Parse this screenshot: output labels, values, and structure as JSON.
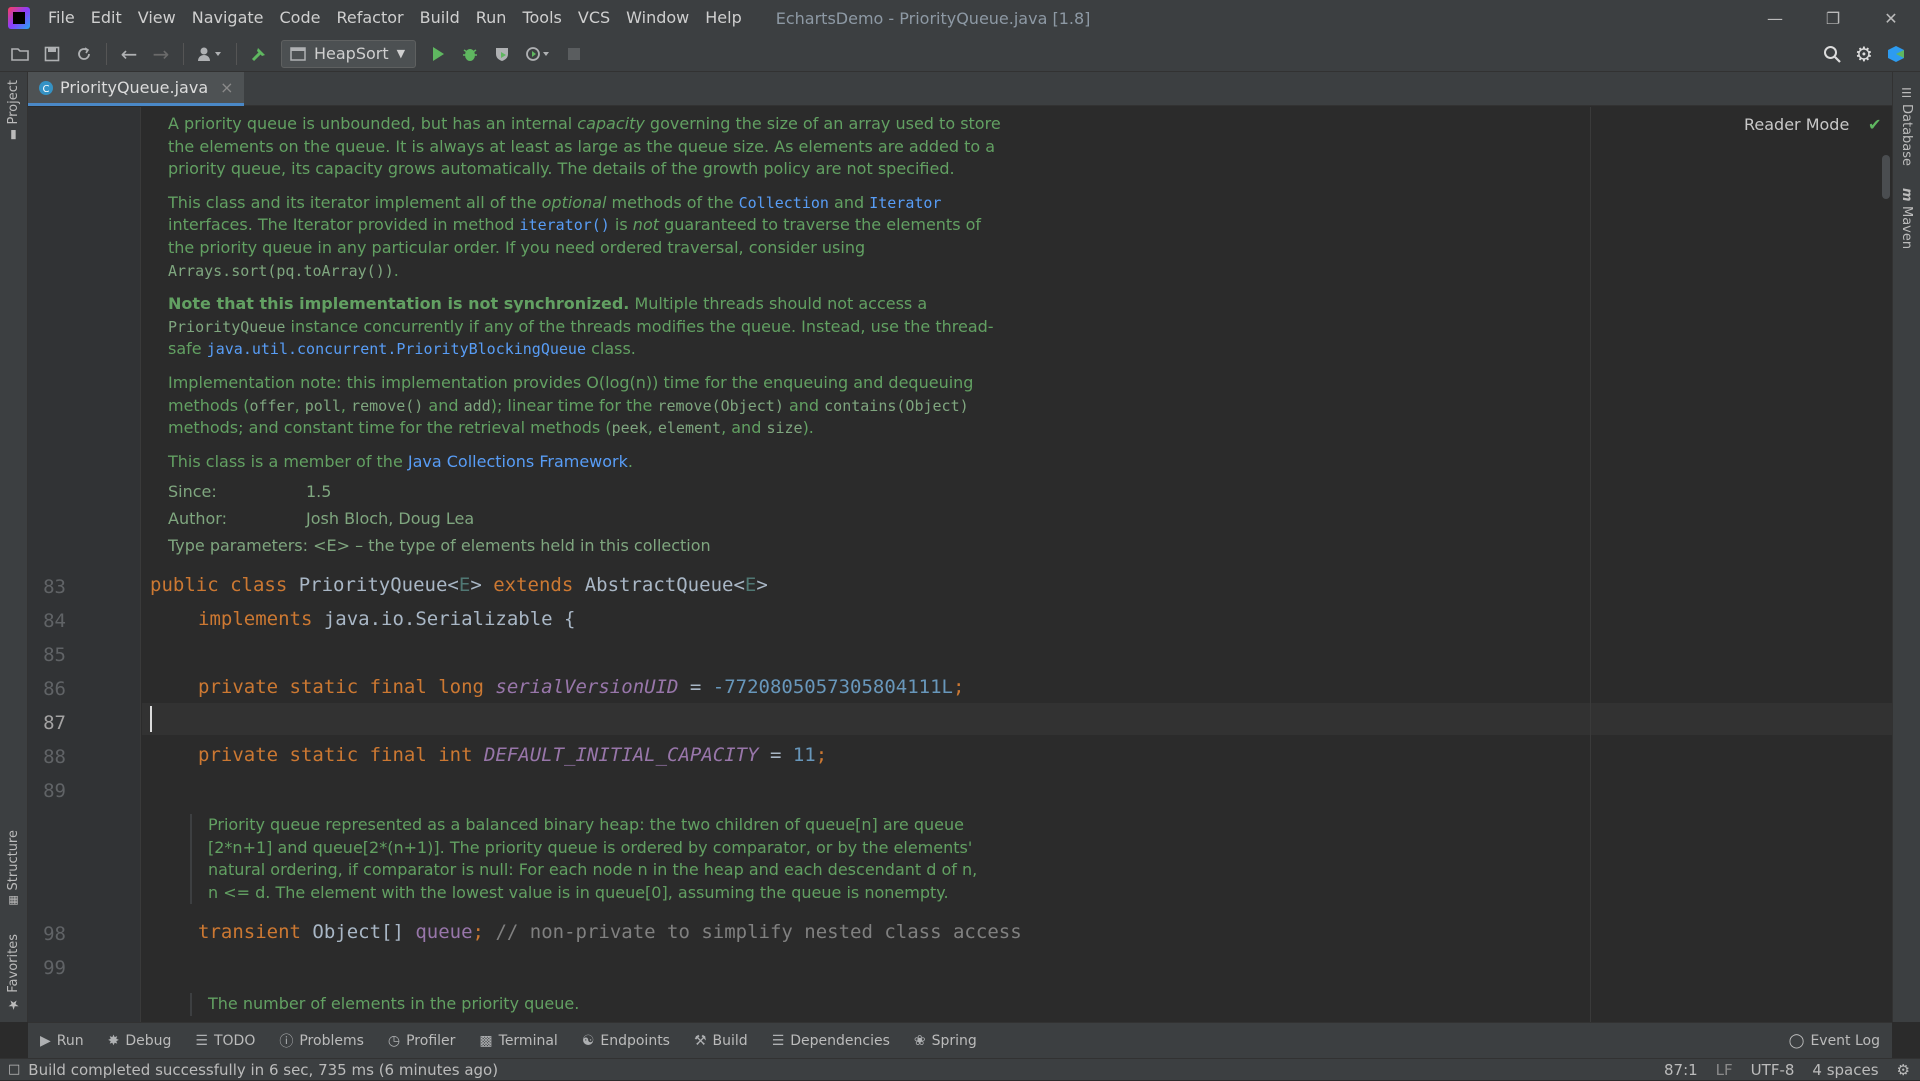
{
  "window": {
    "title": "EchartsDemo - PriorityQueue.java [1.8]",
    "menu": [
      "File",
      "Edit",
      "View",
      "Navigate",
      "Code",
      "Refactor",
      "Build",
      "Run",
      "Tools",
      "VCS",
      "Window",
      "Help"
    ]
  },
  "toolbar": {
    "run_config": "HeapSort"
  },
  "editor_tab": {
    "label": "PriorityQueue.java",
    "close": "×"
  },
  "left_strip": {
    "project": "Project",
    "structure": "Structure",
    "favorites": "Favorites"
  },
  "right_strip": {
    "database": "Database",
    "maven": "Maven"
  },
  "reader_mode": "Reader Mode",
  "doc_top": {
    "p1": {
      "a": "A priority queue is unbounded, but has an internal ",
      "b": "capacity",
      "c": " governing the size of an array used to store the elements on the queue. It is always at least as large as the queue size. As elements are added to a priority queue, its capacity grows automatically. The details of the growth policy are not specified."
    },
    "p2": {
      "a": "This class and its iterator implement all of the ",
      "b": "optional",
      "c": " methods of the ",
      "d": "Collection",
      "e": " and ",
      "f": "Iterator",
      "g": " interfaces. The Iterator provided in method ",
      "h": "iterator()",
      "i": " is ",
      "j": "not",
      "k": " guaranteed to traverse the elements of the priority queue in any particular order. If you need ordered traversal, consider using ",
      "l": "Arrays.sort(pq.toArray())",
      "m": "."
    },
    "p3": {
      "a": "Note that this implementation is not synchronized.",
      "b": " Multiple threads should not access a ",
      "c": "PriorityQueue",
      "d": " instance concurrently if any of the threads modifies the queue. Instead, use the thread-safe ",
      "e": "java.util.concurrent.PriorityBlockingQueue",
      "f": " class."
    },
    "p4": {
      "a": "Implementation note: this implementation provides O(log(n)) time for the enqueuing and dequeuing methods (",
      "b": "offer",
      "c": ", ",
      "d": "poll",
      "e": ", ",
      "f": "remove()",
      "g": " and ",
      "h": "add",
      "i": "); linear time for the ",
      "j": "remove(Object)",
      "k": " and ",
      "l": "contains(Object)",
      "m": " methods; and constant time for the retrieval methods (",
      "n": "peek",
      "o": ", ",
      "p": "element",
      "q": ", and ",
      "r": "size",
      "s": ")."
    },
    "p5": {
      "a": "This class is a member of the ",
      "b": "Java Collections Framework",
      "c": "."
    },
    "since_label": "Since:",
    "since_value": "1.5",
    "author_label": "Author:",
    "author_value": "Josh Bloch, Doug Lea",
    "typeparams": "Type parameters: <E> – the type of elements held in this collection"
  },
  "lines": [
    {
      "n": "83"
    },
    {
      "n": "84"
    },
    {
      "n": "85"
    },
    {
      "n": "86"
    },
    {
      "n": "87"
    },
    {
      "n": "88"
    },
    {
      "n": "89"
    },
    {
      "n": "98"
    },
    {
      "n": "99"
    }
  ],
  "code": {
    "l83": {
      "kw1": "public class ",
      "cls": "PriorityQueue<",
      "tp": "E",
      "mid": "> ",
      "kw2": "extends ",
      "sup": "AbstractQueue<",
      "tp2": "E",
      "end": ">"
    },
    "l84": {
      "kw": "implements ",
      "rest": "java.io.Serializable {"
    },
    "l86": {
      "kw": "private static final long ",
      "fld": "serialVersionUID",
      "eq": " = ",
      "num": "-7720805057305804111L",
      "end": ";"
    },
    "l88": {
      "kw": "private static final int ",
      "fld": "DEFAULT_INITIAL_CAPACITY",
      "eq": " = ",
      "num": "11",
      "end": ";"
    },
    "l98": {
      "kw": "transient ",
      "type": "Object[] ",
      "fld": "queue",
      "semi": "; ",
      "cmt": "// non-private to simplify nested class access"
    }
  },
  "doc_mid": "Priority queue represented as a balanced binary heap: the two children of queue[n] are queue [2*n+1] and queue[2*(n+1)]. The priority queue is ordered by comparator, or by the elements' natural ordering, if comparator is null: For each node n in the heap and each descendant d of n, n <= d. The element with the lowest value is in queue[0], assuming the queue is nonempty.",
  "doc_bottom": "The number of elements in the priority queue.",
  "bottom_tools": [
    "Run",
    "Debug",
    "TODO",
    "Problems",
    "Profiler",
    "Terminal",
    "Endpoints",
    "Build",
    "Dependencies",
    "Spring"
  ],
  "event_log": "Event Log",
  "status": {
    "message": "Build completed successfully in 6 sec, 735 ms (6 minutes ago)",
    "position": "87:1",
    "line_sep": "LF",
    "encoding": "UTF-8",
    "indent": "4 spaces"
  }
}
